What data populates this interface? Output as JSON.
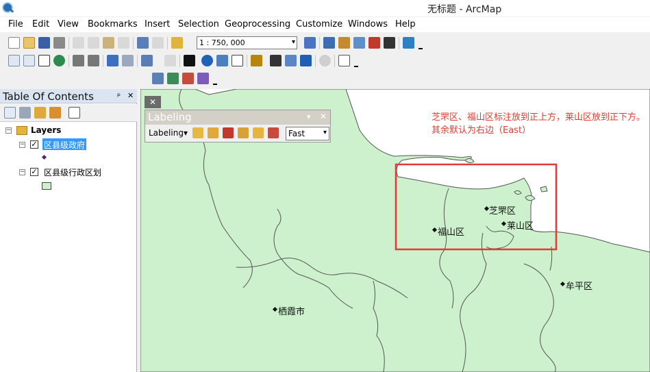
{
  "window": {
    "title": "无标题 - ArcMap"
  },
  "menu": [
    "File",
    "Edit",
    "View",
    "Bookmarks",
    "Insert",
    "Selection",
    "Geoprocessing",
    "Customize",
    "Windows",
    "Help"
  ],
  "toolbar": {
    "scale_value": "1 : 750, 000"
  },
  "toc": {
    "title": "Table Of Contents",
    "pin": "ᵖ",
    "close": "✕",
    "root": "Layers",
    "layers": [
      {
        "name": "区县级政府",
        "selected": true
      },
      {
        "name": "区县级行政区划",
        "selected": false
      }
    ]
  },
  "labeling": {
    "title": "Labeling",
    "menu_label": "Labeling",
    "mode": "Fast",
    "close": "✕",
    "dropdown": "▾"
  },
  "map": {
    "close": "✕",
    "annotation": "芝罘区、福山区标注放到正上方，莱山区放到正下方。其余默认为右边（East）",
    "labels": [
      "芝罘区",
      "福山区",
      "莱山区",
      "牟平区",
      "栖霞市"
    ],
    "colors": {
      "land": "#cdf0cd",
      "highlight": "#e53935",
      "sea": "#ffffff"
    }
  }
}
